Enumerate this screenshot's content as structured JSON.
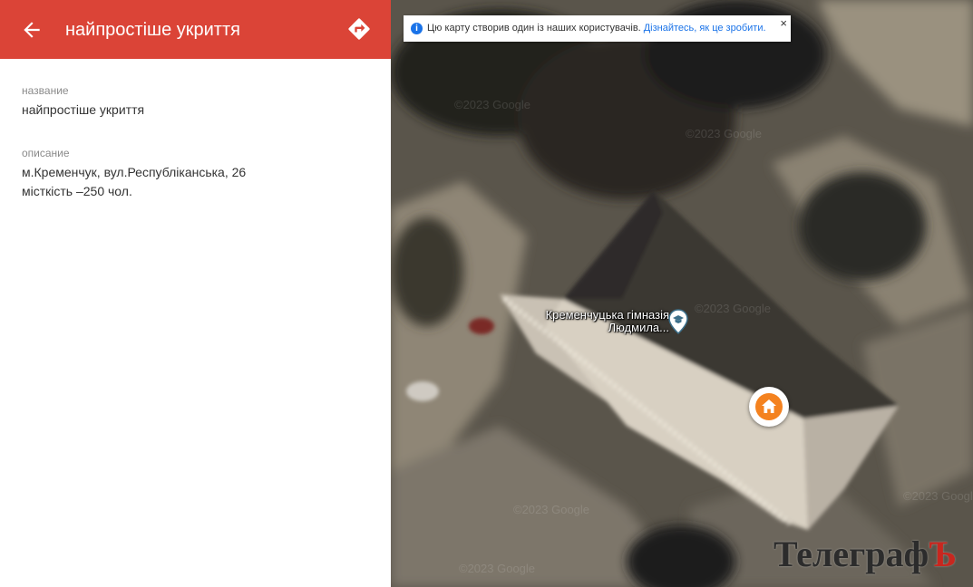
{
  "header": {
    "title": "найпростіше укриття",
    "back_icon": "arrow-left-icon",
    "directions_icon": "directions-icon"
  },
  "details": {
    "name_label": "название",
    "name_value": "найпростіше укриття",
    "description_label": "описание",
    "description_lines": [
      "м.Кременчук, вул.Республіканська, 26",
      "місткість –250 чол."
    ]
  },
  "map": {
    "banner_text": "Цю карту створив один із наших користувачів.",
    "banner_link": "Дізнайтесь, як це зробити.",
    "banner_close": "×",
    "poi_label": "Кременчуцька гімназія Людмила...",
    "poi_icon": "school-pin-icon",
    "marker_icon": "home-icon",
    "watermark": "©2023 Google",
    "brand_text": "Телеграф",
    "brand_mark": "Ъ"
  },
  "colors": {
    "header": "#db4437",
    "link": "#1a73e8",
    "marker": "#f4821f"
  }
}
